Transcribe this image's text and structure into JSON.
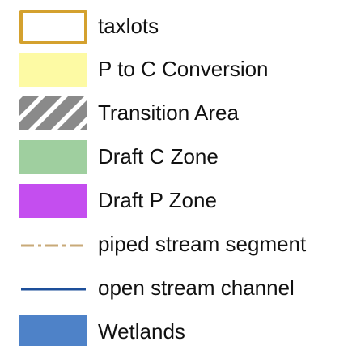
{
  "legend": {
    "items": [
      {
        "label": "taxlots",
        "symbol": "outline-box",
        "color": "#d4a12e"
      },
      {
        "label": "P to C Conversion",
        "symbol": "fill-box",
        "color": "#fdfaa4"
      },
      {
        "label": "Transition Area",
        "symbol": "hatch-box",
        "color": "#8a8a8a"
      },
      {
        "label": "Draft C Zone",
        "symbol": "fill-box",
        "color": "#9fcf9f"
      },
      {
        "label": "Draft P Zone",
        "symbol": "fill-box",
        "color": "#c44eef"
      },
      {
        "label": "piped stream segment",
        "symbol": "dash-dot-line",
        "color": "#c8aa78"
      },
      {
        "label": "open stream channel",
        "symbol": "solid-line",
        "color": "#1d4f9a"
      },
      {
        "label": "Wetlands",
        "symbol": "fill-box",
        "color": "#4e82c8"
      }
    ]
  }
}
